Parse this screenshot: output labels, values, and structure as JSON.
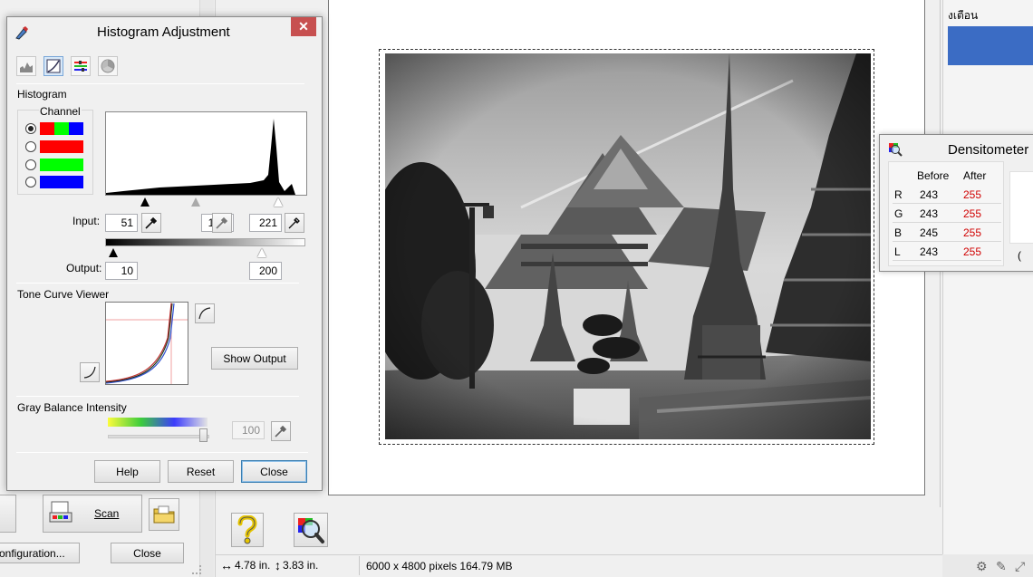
{
  "histogram": {
    "title": "Histogram Adjustment",
    "section_histogram": "Histogram",
    "channel_label": "Channel",
    "channels": [
      {
        "id": "rgb",
        "selected": true
      },
      {
        "id": "red",
        "selected": false
      },
      {
        "id": "green",
        "selected": false
      },
      {
        "id": "blue",
        "selected": false
      }
    ],
    "input_label": "Input:",
    "input_shadow": "51",
    "input_gamma": "1.42",
    "input_highlight": "221",
    "output_label": "Output:",
    "output_low": "10",
    "output_high": "200",
    "section_tone": "Tone Curve Viewer",
    "show_output": "Show Output",
    "section_gray": "Gray Balance Intensity",
    "gray_value": "100",
    "help": "Help",
    "reset": "Reset",
    "close": "Close"
  },
  "densitometer": {
    "title": "Densitometer",
    "col_before": "Before",
    "col_after": "After",
    "rows": [
      {
        "ch": "R",
        "before": "243",
        "after": "255"
      },
      {
        "ch": "G",
        "before": "243",
        "after": "255"
      },
      {
        "ch": "B",
        "before": "245",
        "after": "255"
      },
      {
        "ch": "L",
        "before": "243",
        "after": "255"
      }
    ],
    "partial_char": "("
  },
  "main": {
    "scan_label": "Scan",
    "configuration_label": "onfiguration...",
    "close_label": "Close",
    "thai_text": "งเตือน",
    "status_width": "4.78 in.",
    "status_height": "3.83 in.",
    "status_info": "6000 x 4800 pixels 164.79 MB"
  },
  "colors": {
    "red": "#ff0000",
    "green": "#00ff00",
    "blue": "#0000ff",
    "accent_blue": "#3b6cc4",
    "value_red": "#d00000"
  }
}
